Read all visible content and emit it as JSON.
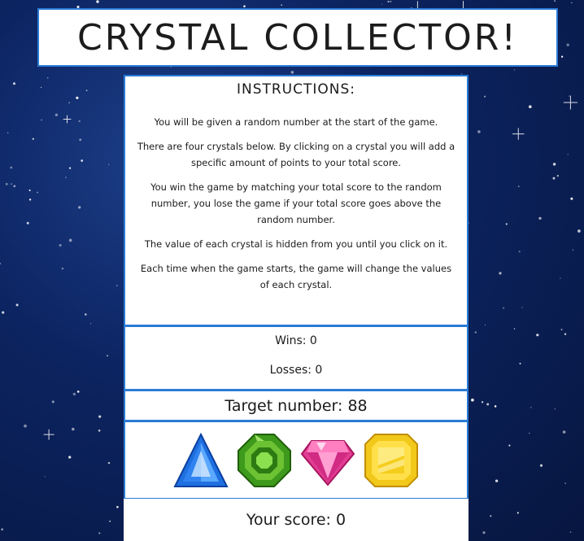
{
  "header": {
    "title": "CRYSTAL COLLECTOR!"
  },
  "instructions": {
    "heading": "INSTRUCTIONS:",
    "paragraphs": [
      "You will be given a random number at the start of the game.",
      "There are four crystals below. By clicking on a crystal you will add a specific amount of points to your total score.",
      "You win the game by matching your total score to the random number, you lose the game if your total score goes above the random number.",
      "The value of each crystal is hidden from you until you click on it.",
      "Each time when the game starts, the game will change the values of each crystal."
    ]
  },
  "record": {
    "wins_text": "Wins: 0",
    "losses_text": "Losses: 0"
  },
  "target": {
    "text": "Target number: 88"
  },
  "crystals": [
    {
      "name": "blue-triangle-crystal",
      "color": "#1f6fe0"
    },
    {
      "name": "green-octagon-crystal",
      "color": "#3d9a1c"
    },
    {
      "name": "pink-diamond-crystal",
      "color": "#e23d92"
    },
    {
      "name": "yellow-square-crystal",
      "color": "#f2c81a"
    }
  ],
  "score": {
    "text": "Your score: 0"
  },
  "colors": {
    "panel_border": "#2a7bd6",
    "background": "#0c2461"
  }
}
